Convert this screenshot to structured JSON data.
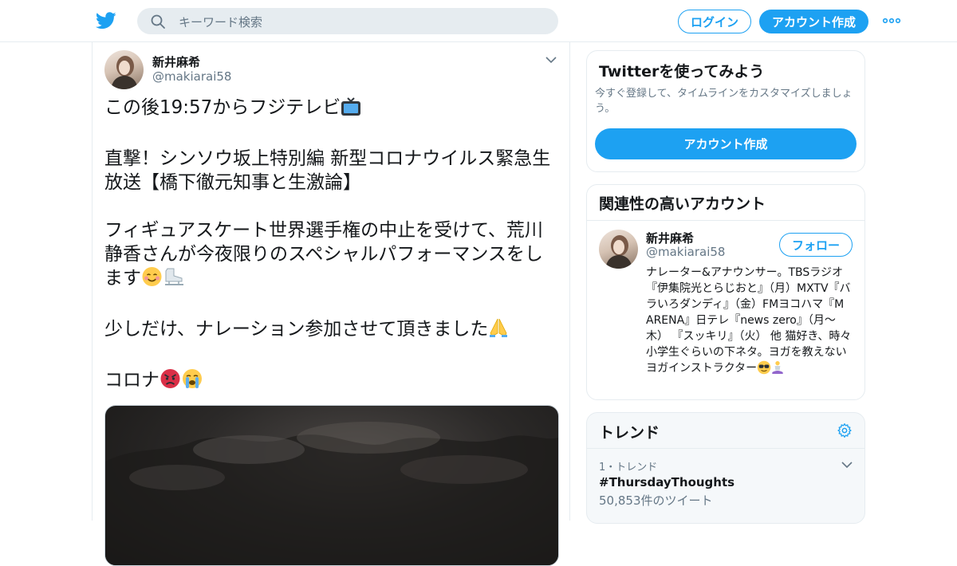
{
  "colors": {
    "accent": "#1da1f2",
    "text": "#14171a",
    "secondary_text": "#657786",
    "border": "#e6ecf0",
    "search_bg": "#e6ecf0"
  },
  "header": {
    "logo_icon": "twitter-bird-icon",
    "search_placeholder": "キーワード検索",
    "login_label": "ログイン",
    "signup_label": "アカウント作成",
    "more_icon": "more-dots-icon"
  },
  "tweet": {
    "author_name": "新井麻希",
    "author_handle": "@makiarai58",
    "lines": [
      "この後19:57からフジテレビ",
      "直撃！シンソウ坂上特別編 新型コロナウイルス緊急生放送【橋下徹元知事と生激論】",
      "フィギュアスケート世界選手権の中止を受けて、荒川静香さんが今夜限りのスペシャルパフォーマンスをします",
      "少しだけ、ナレーション参加させて頂きました",
      "コロナ"
    ],
    "emoji": {
      "tv": "television-emoji",
      "smiling": "smiling-face-emoji",
      "skate": "ice-skate-emoji",
      "pray": "folded-hands-emoji",
      "angry": "angry-face-emoji",
      "crying": "loudly-crying-face-emoji"
    }
  },
  "signup_card": {
    "title": "Twitterを使ってみよう",
    "description": "今すぐ登録して、タイムラインをカスタマイズしましょう。",
    "button_label": "アカウント作成"
  },
  "related_card": {
    "title": "関連性の高いアカウント",
    "account": {
      "name": "新井麻希",
      "handle": "@makiarai58",
      "follow_label": "フォロー",
      "bio": "ナレーター&アナウンサー。TBSラジオ『伊集院光とらじおと』（月）MXTV『バラいろダンディ』（金）FMヨコハマ『M ARENA』日テレ『news zero』（月〜木） 『スッキリ』（火） 他 猫好き、時々小学生ぐらいの下ネタ。ヨガを教えないヨガインストラクター"
    }
  },
  "trends_card": {
    "title": "トレンド",
    "items": [
      {
        "meta": "1・トレンド",
        "tag": "#ThursdayThoughts",
        "count": "50,853件のツイート"
      }
    ]
  }
}
